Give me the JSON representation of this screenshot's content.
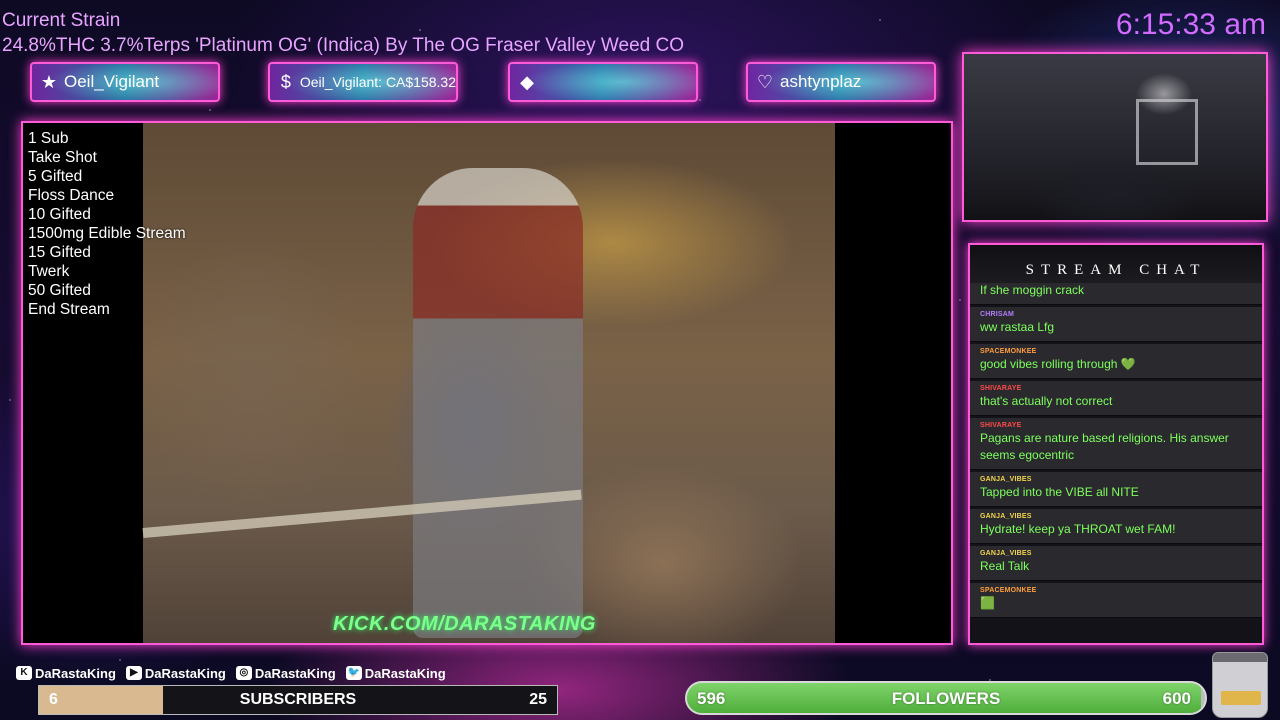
{
  "header": {
    "strain_title": "Current Strain",
    "strain_info": "24.8%THC 3.7%Terps 'Platinum OG' (Indica) By The OG Fraser Valley Weed CO",
    "clock": "6:15:33 am"
  },
  "alerts": [
    {
      "icon": "star-icon",
      "glyph": "★",
      "text": "Oeil_Vigilant"
    },
    {
      "icon": "dollar-icon",
      "glyph": "$",
      "text": "Oeil_Vigilant: CA$158.32"
    },
    {
      "icon": "diamond-icon",
      "glyph": "◆",
      "text": ""
    },
    {
      "icon": "heart-icon",
      "glyph": "♡",
      "text": "ashtynplaz"
    }
  ],
  "goals": [
    "1 Sub",
    "Take Shot",
    "5 Gifted",
    "Floss Dance",
    "10 Gifted",
    "1500mg Edible Stream",
    "15 Gifted",
    "Twerk",
    "50 Gifted",
    "End Stream"
  ],
  "video": {
    "overlay_link": "KICK.COM/DARASTAKING"
  },
  "chat": {
    "title": "STREAM CHAT",
    "messages": [
      {
        "user": "",
        "text": "If she moggin crack",
        "color": ""
      },
      {
        "user": "CHRISAM",
        "text": "ww rastaa Lfg",
        "color": "#b57cff"
      },
      {
        "user": "SPACEMONKEE",
        "text": "good vibes rolling through 💚",
        "color": "#ff9d3b"
      },
      {
        "user": "SHIVARAYE",
        "text": "that's actually not correct",
        "color": "#ff4a4a"
      },
      {
        "user": "SHIVARAYE",
        "text": "Pagans are nature based religions. His answer seems egocentric",
        "color": "#ff4a4a"
      },
      {
        "user": "GANJA_VIBES",
        "text": "Tapped into the VIBE all NITE",
        "color": "#f3d54b"
      },
      {
        "user": "GANJA_VIBES",
        "text": "Hydrate! keep ya THROAT wet FAM!",
        "color": "#f3d54b"
      },
      {
        "user": "GANJA_VIBES",
        "text": "Real Talk",
        "color": "#f3d54b"
      },
      {
        "user": "SPACEMONKEE",
        "text": "🟩",
        "color": "#ff9d3b"
      }
    ]
  },
  "socials": [
    {
      "icon": "kick-icon",
      "glyph": "K",
      "handle": "DaRastaKing"
    },
    {
      "icon": "youtube-icon",
      "glyph": "▶",
      "handle": "DaRastaKing"
    },
    {
      "icon": "instagram-icon",
      "glyph": "◎",
      "handle": "DaRastaKing"
    },
    {
      "icon": "twitter-icon",
      "glyph": "🐦",
      "handle": "DaRastaKing"
    }
  ],
  "subs": {
    "current": "6",
    "label": "SUBSCRIBERS",
    "goal": "25",
    "progress": 0.24
  },
  "followers": {
    "current": "596",
    "label": "FOLLOWERS",
    "goal": "600",
    "progress": 0.993
  },
  "colors": {
    "accent_pink": "#ff5ad8",
    "chat_text_green": "#7dff5c",
    "clock_purple": "#d26bff",
    "follower_green": "#6cc557"
  }
}
